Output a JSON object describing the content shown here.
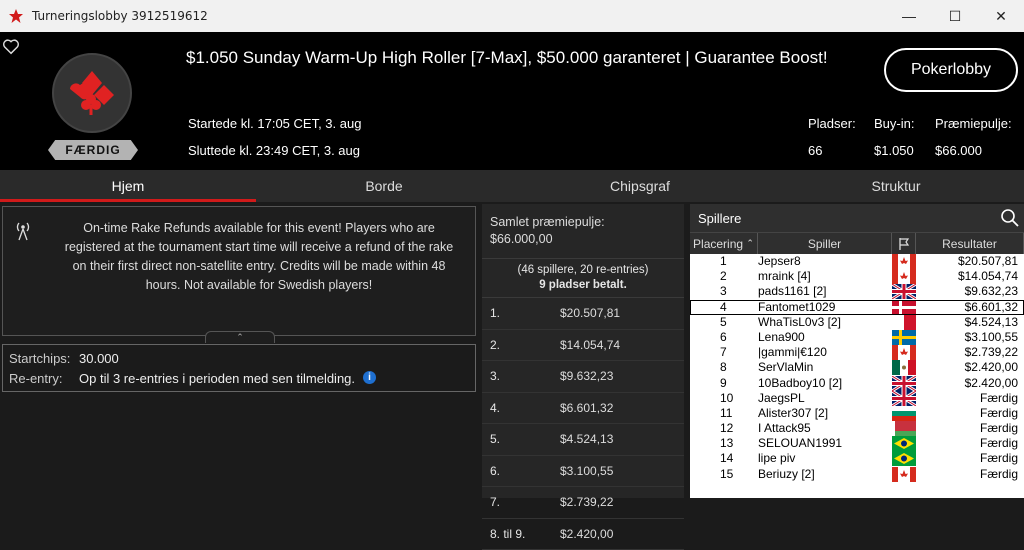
{
  "window": {
    "title": "Turneringslobby 3912519612"
  },
  "header": {
    "title": "$1.050 Sunday Warm-Up High Roller [7-Max], $50.000 garanteret | Guarantee Boost!",
    "started": "Startede kl. 17:05 CET, 3. aug",
    "ended": "Sluttede kl. 23:49 CET, 3. aug",
    "status": "FÆRDIG",
    "lobby_button": "Pokerlobby",
    "stats": [
      {
        "label": "Pladser:",
        "value": "66"
      },
      {
        "label": "Buy-in:",
        "value": "$1.050"
      },
      {
        "label": "Præmiepulje:",
        "value": "$66.000"
      }
    ]
  },
  "tabs": [
    "Hjem",
    "Borde",
    "Chipsgraf",
    "Struktur"
  ],
  "info": {
    "text": "On-time Rake Refunds available for this event! Players who are registered at the tournament start time will receive a refund of the rake on their first direct non-satellite entry. Credits will be made within 48 hours. Not available for Swedish players!"
  },
  "chips": {
    "startchips_label": "Startchips:",
    "startchips_value": "30.000",
    "reentry_label": "Re-entry:",
    "reentry_value": "Op til 3 re-entries i perioden med sen tilmelding."
  },
  "prize": {
    "label": "Samlet præmiepulje:",
    "total": "$66.000,00",
    "entrants": "(46 spillere, 20 re-entries)",
    "paid": "9 pladser betalt.",
    "rows": [
      {
        "place": "1.",
        "amount": "$20.507,81"
      },
      {
        "place": "2.",
        "amount": "$14.054,74"
      },
      {
        "place": "3.",
        "amount": "$9.632,23"
      },
      {
        "place": "4.",
        "amount": "$6.601,32"
      },
      {
        "place": "5.",
        "amount": "$4.524,13"
      },
      {
        "place": "6.",
        "amount": "$3.100,55"
      },
      {
        "place": "7.",
        "amount": "$2.739,22"
      },
      {
        "place": "8. til 9.",
        "amount": "$2.420,00"
      }
    ]
  },
  "players": {
    "search_label": "Spillere",
    "headers": {
      "place": "Placering",
      "player": "Spiller",
      "result": "Resultater"
    },
    "rows": [
      {
        "place": "1",
        "name": "Jepser8",
        "flag": "canada",
        "result": "$20.507,81"
      },
      {
        "place": "2",
        "name": "mraink [4]",
        "flag": "canada",
        "result": "$14.054,74"
      },
      {
        "place": "3",
        "name": "pads1161 [2]",
        "flag": "uk",
        "result": "$9.632,23"
      },
      {
        "place": "4",
        "name": "Fantomet1029",
        "flag": "denmark",
        "result": "$6.601,32"
      },
      {
        "place": "5",
        "name": "WhaTisL0v3 [2]",
        "flag": "malta",
        "result": "$4.524,13"
      },
      {
        "place": "6",
        "name": "Lena900",
        "flag": "sweden",
        "result": "$3.100,55"
      },
      {
        "place": "7",
        "name": "|gammi|€120",
        "flag": "canada",
        "result": "$2.739,22"
      },
      {
        "place": "8",
        "name": "SerVlaMin",
        "flag": "mexico",
        "result": "$2.420,00"
      },
      {
        "place": "9",
        "name": "10Badboy10 [2]",
        "flag": "uk",
        "result": "$2.420,00"
      },
      {
        "place": "10",
        "name": "JaegsPL",
        "flag": "uk",
        "result": "Færdig"
      },
      {
        "place": "11",
        "name": "Alister307 [2]",
        "flag": "bulgaria",
        "result": "Færdig"
      },
      {
        "place": "12",
        "name": "I Attack95",
        "flag": "belarus",
        "result": "Færdig"
      },
      {
        "place": "13",
        "name": "SELOUAN1991",
        "flag": "brazil",
        "result": "Færdig"
      },
      {
        "place": "14",
        "name": "lipe piv",
        "flag": "brazil",
        "result": "Færdig"
      },
      {
        "place": "15",
        "name": "Beriuzy [2]",
        "flag": "canada",
        "result": "Færdig"
      }
    ]
  },
  "colors": {
    "accent": "#d11a1a",
    "background": "#1b1b1b",
    "selected_row": "#ffffff"
  }
}
